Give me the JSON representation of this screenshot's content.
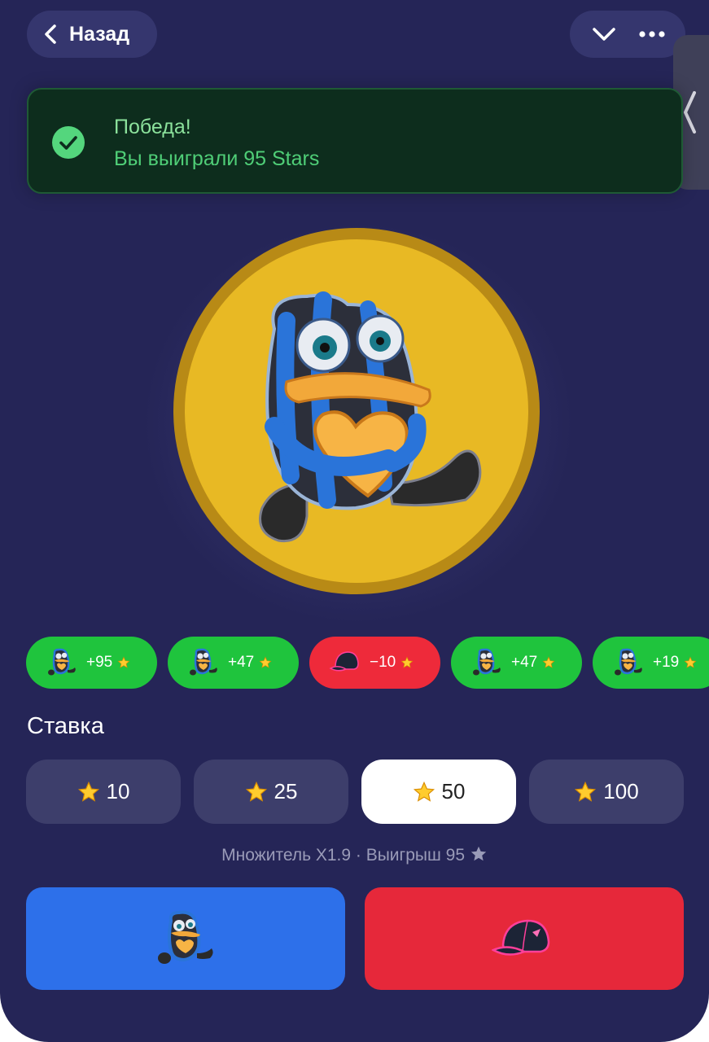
{
  "header": {
    "back_label": "Назад",
    "chevron_icon": "chevron-down-icon",
    "more_icon": "more-dots-icon"
  },
  "notification": {
    "title": "Победа!",
    "text": "Вы выиграли 95 Stars",
    "icon": "check-circle-icon"
  },
  "history": [
    {
      "result": "+95",
      "outcome": "win",
      "icon": "frog-sticker-icon"
    },
    {
      "result": "+47",
      "outcome": "win",
      "icon": "frog-sticker-icon"
    },
    {
      "result": "−10",
      "outcome": "lose",
      "icon": "cap-icon"
    },
    {
      "result": "+47",
      "outcome": "win",
      "icon": "frog-sticker-icon"
    },
    {
      "result": "+19",
      "outcome": "win",
      "icon": "frog-sticker-icon"
    }
  ],
  "stake": {
    "title": "Ставка",
    "options": [
      "10",
      "25",
      "50",
      "100"
    ],
    "selected": "50"
  },
  "info_text": "Множитель X1.9 · Выигрыш 95",
  "colors": {
    "background": "#252557",
    "win": "#1fc43d",
    "lose": "#ee2a3a",
    "coin": "#e8b924",
    "frog_button": "#2d70ea",
    "cap_button": "#e6283a"
  }
}
